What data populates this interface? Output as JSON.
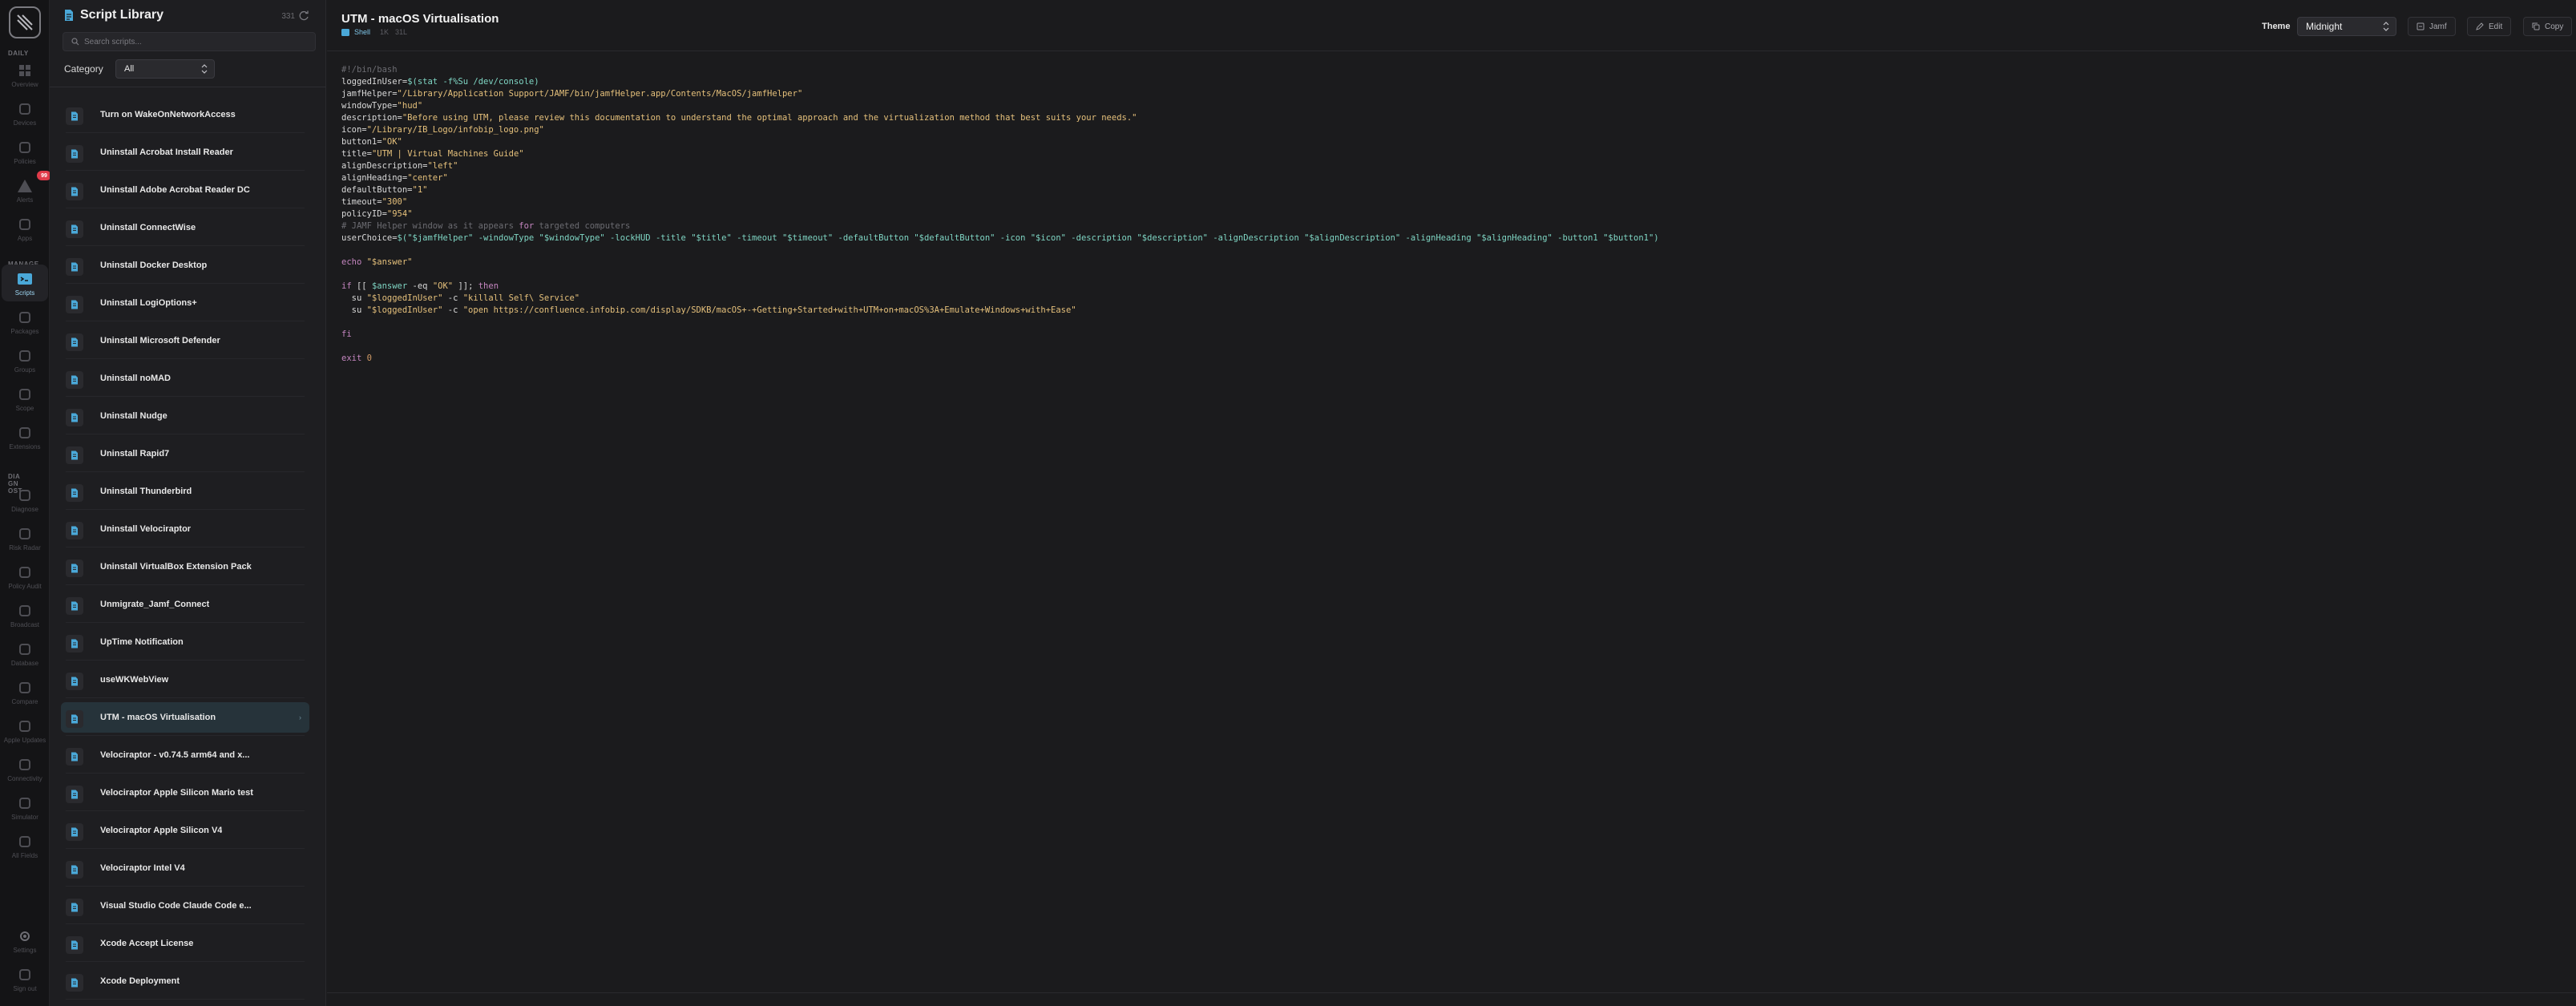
{
  "rail": {
    "section_daily": "DAILY",
    "section_manage": "MANAGE",
    "section_dia": "DIA GN OST",
    "items": [
      {
        "label": "Overview",
        "icon": "grid-icon"
      },
      {
        "label": "Devices",
        "icon": "laptop-icon"
      },
      {
        "label": "Policies",
        "icon": "policy-icon"
      },
      {
        "label": "Alerts",
        "icon": "warning-icon"
      },
      {
        "label": "Apps",
        "icon": "cube-icon"
      },
      {
        "label": "Scripts",
        "icon": "terminal-icon"
      },
      {
        "label": "Packages",
        "icon": "package-icon"
      },
      {
        "label": "Groups",
        "icon": "users-icon"
      },
      {
        "label": "Scope",
        "icon": "target-icon"
      },
      {
        "label": "Extensions",
        "icon": "puzzle-icon"
      },
      {
        "label": "Diagnose",
        "icon": "diagnose-icon"
      },
      {
        "label": "Risk Radar",
        "icon": "alert-icon"
      },
      {
        "label": "Policy Audit",
        "icon": "audit-icon"
      },
      {
        "label": "Broadcast",
        "icon": "broadcast-icon"
      },
      {
        "label": "Database",
        "icon": "database-icon"
      },
      {
        "label": "Compare",
        "icon": "compare-icon"
      },
      {
        "label": "Apple Updates",
        "icon": "apple-icon"
      },
      {
        "label": "Connectivity",
        "icon": "wifi-icon"
      },
      {
        "label": "Simulator",
        "icon": "simulator-icon"
      },
      {
        "label": "All Fields",
        "icon": "fields-icon"
      },
      {
        "label": "Settings",
        "icon": "gear-icon"
      },
      {
        "label": "Sign out",
        "icon": "signout-icon"
      }
    ],
    "alert_badge": "99"
  },
  "sidebar": {
    "title": "Script Library",
    "count": "331",
    "search_placeholder": "Search scripts...",
    "category_label": "Category",
    "category_value": "All",
    "items": [
      "Turn on WakeOnNetworkAccess",
      "Uninstall Acrobat Install Reader",
      "Uninstall Adobe Acrobat Reader DC",
      "Uninstall ConnectWise",
      "Uninstall Docker Desktop",
      "Uninstall LogiOptions+",
      "Uninstall Microsoft Defender",
      "Uninstall noMAD",
      "Uninstall Nudge",
      "Uninstall Rapid7",
      "Uninstall Thunderbird",
      "Uninstall Velociraptor",
      "Uninstall VirtualBox Extension Pack",
      "Unmigrate_Jamf_Connect",
      "UpTime Notification",
      "useWKWebView",
      "UTM - macOS Virtualisation",
      "Velociraptor - v0.74.5 arm64 and x...",
      "Velociraptor Apple Silicon Mario test",
      "Velociraptor Apple Silicon V4",
      "Velociraptor Intel V4",
      "Visual Studio Code Claude Code e...",
      "Xcode Accept License",
      "Xcode Deployment"
    ],
    "selected_index": 16
  },
  "main": {
    "title": "UTM - macOS Virtualisation",
    "language": "Shell",
    "size": "1K",
    "lines_info": "31L",
    "theme_label": "Theme",
    "theme_value": "Midnight",
    "btn_jamf": "Jamf",
    "btn_edit": "Edit",
    "btn_copy": "Copy"
  },
  "code_lines": [
    [
      [
        "c",
        "#!/bin/bash"
      ]
    ],
    [
      [
        "v",
        "loggedInUser="
      ],
      [
        "m",
        "$(stat -f%Su /dev/console)"
      ]
    ],
    [
      [
        "v",
        "jamfHelper="
      ],
      [
        "s",
        "\"/Library/Application Support/JAMF/bin/jamfHelper.app/Contents/MacOS/jamfHelper\""
      ]
    ],
    [
      [
        "v",
        "windowType="
      ],
      [
        "s",
        "\"hud\""
      ]
    ],
    [
      [
        "v",
        "description="
      ],
      [
        "s",
        "\"Before using UTM, please review this documentation to understand the optimal approach and the virtualization method that best suits your needs.\""
      ]
    ],
    [
      [
        "v",
        "icon="
      ],
      [
        "s",
        "\"/Library/IB_Logo/infobip_logo.png\""
      ]
    ],
    [
      [
        "v",
        "button1="
      ],
      [
        "s",
        "\"OK\""
      ]
    ],
    [
      [
        "v",
        "title="
      ],
      [
        "s",
        "\"UTM | Virtual Machines Guide\""
      ]
    ],
    [
      [
        "v",
        "alignDescription="
      ],
      [
        "s",
        "\"left\""
      ]
    ],
    [
      [
        "v",
        "alignHeading="
      ],
      [
        "s",
        "\"center\""
      ]
    ],
    [
      [
        "v",
        "defaultButton="
      ],
      [
        "s",
        "\"1\""
      ]
    ],
    [
      [
        "v",
        "timeout="
      ],
      [
        "s",
        "\"300\""
      ]
    ],
    [
      [
        "v",
        "policyID="
      ],
      [
        "s",
        "\"954\""
      ]
    ],
    [
      [
        "c",
        "# JAMF Helper window as it appears "
      ],
      [
        "k",
        "for"
      ],
      [
        "c",
        " targeted computers"
      ]
    ],
    [
      [
        "v",
        "userChoice="
      ],
      [
        "m",
        "$(\"$jamfHelper\" -windowType \"$windowType\" -lockHUD -title \"$title\" -timeout \"$timeout\" -defaultButton \"$defaultButton\" -icon \"$icon\" -description \"$description\" -alignDescription \"$alignDescription\" -alignHeading \"$alignHeading\" -button1 \"$button1\")"
      ]
    ],
    [],
    [
      [
        "k",
        "echo "
      ],
      [
        "s",
        "\"$answer\""
      ]
    ],
    [],
    [
      [
        "k",
        "if"
      ],
      [
        "v",
        " [[ "
      ],
      [
        "m",
        "$answer"
      ],
      [
        "v",
        " -eq "
      ],
      [
        "s",
        "\"OK\""
      ],
      [
        "v",
        " ]]; "
      ],
      [
        "k",
        "then"
      ]
    ],
    [
      [
        "v",
        "  su "
      ],
      [
        "s",
        "\"$loggedInUser\""
      ],
      [
        "v",
        " -c "
      ],
      [
        "s",
        "\"killall Self\\ Service\""
      ]
    ],
    [
      [
        "v",
        "  su "
      ],
      [
        "s",
        "\"$loggedInUser\""
      ],
      [
        "v",
        " -c "
      ],
      [
        "s",
        "\"open https://confluence.infobip.com/display/SDKB/macOS+-+Getting+Started+with+UTM+on+macOS%3A+Emulate+Windows+with+Ease\""
      ]
    ],
    [],
    [
      [
        "k",
        "fi"
      ]
    ],
    [],
    [
      [
        "k",
        "exit "
      ],
      [
        "n",
        "0"
      ]
    ]
  ],
  "colors": {
    "accent": "#7fc7ea",
    "selected_bg": "#26333a",
    "badge": "#e03b4a"
  }
}
